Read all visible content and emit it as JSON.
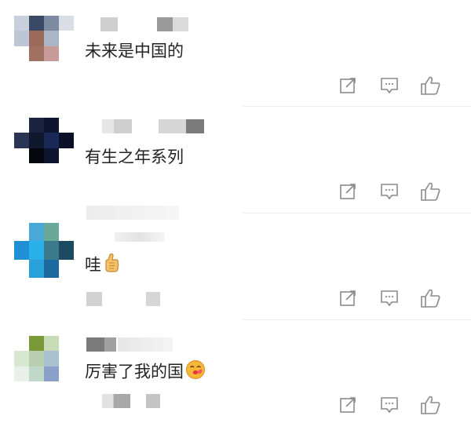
{
  "comments": [
    {
      "text": "未来是中国的",
      "avatar_pixels": [
        "#c8d0dc",
        "#3a4a66",
        "#7e8aa0",
        "#d9dde6",
        "#bcc6d4",
        "#9c6a5a",
        "#aab6c6",
        "#ffffff",
        "#ffffff",
        "#a07060",
        "#c89a9a",
        "#ffffff"
      ],
      "actions": {
        "share_icon": "share-icon",
        "reply_icon": "reply-icon",
        "like_icon": "like-icon"
      }
    },
    {
      "text": "有生之年系列",
      "avatar_pixels": [
        "#ffffff",
        "#1a2440",
        "#0f1530",
        "#ffffff",
        "#2a3454",
        "#101830",
        "#1a2858",
        "#0a1028",
        "#ffffff",
        "#05070f",
        "#0e1430",
        "#ffffff"
      ],
      "actions": {
        "share_icon": "share-icon",
        "reply_icon": "reply-icon",
        "like_icon": "like-icon"
      }
    },
    {
      "text": "哇",
      "emoji": "thumbs-up-emoji",
      "avatar_pixels": [
        "#ffffff",
        "#4aa8d8",
        "#6aa89a",
        "#ffffff",
        "#1f8fd6",
        "#2ab0e8",
        "#3a7a8a",
        "#1c4a60",
        "#ffffff",
        "#2aa0d8",
        "#1a6aa0",
        "#ffffff"
      ],
      "actions": {
        "share_icon": "share-icon",
        "reply_icon": "reply-icon",
        "like_icon": "like-icon"
      }
    },
    {
      "text": "厉害了我的国",
      "emoji": "kiss-face-emoji",
      "avatar_pixels": [
        "#ffffff",
        "#7a9a3a",
        "#c8dcb8",
        "#ffffff",
        "#d8e8d0",
        "#b8d0b0",
        "#a8c0d0",
        "#ffffff",
        "#e8f0e8",
        "#c0d8c8",
        "#8aa0c8",
        "#ffffff"
      ],
      "actions": {
        "share_icon": "share-icon",
        "reply_icon": "reply-icon",
        "like_icon": "like-icon"
      }
    }
  ],
  "colors": {
    "icon": "#8a8a8a",
    "text": "#222222",
    "divider": "#ececec"
  }
}
